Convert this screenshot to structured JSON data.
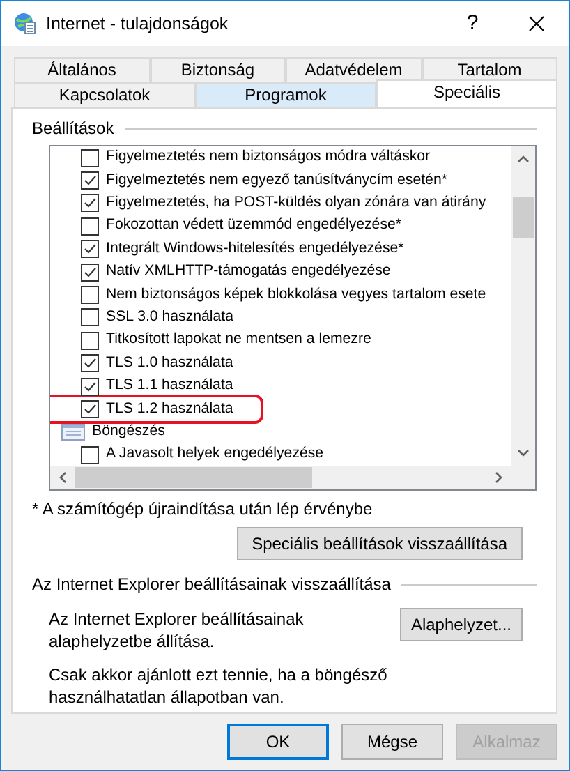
{
  "window": {
    "title": "Internet - tulajdonságok",
    "help": "?"
  },
  "tab_rows": [
    [
      {
        "label": "Általános",
        "selected": false,
        "hovered": false
      },
      {
        "label": "Biztonság",
        "selected": false,
        "hovered": false
      },
      {
        "label": "Adatvédelem",
        "selected": false,
        "hovered": false
      },
      {
        "label": "Tartalom",
        "selected": false,
        "hovered": false
      }
    ],
    [
      {
        "label": "Kapcsolatok",
        "selected": false,
        "hovered": false
      },
      {
        "label": "Programok",
        "selected": false,
        "hovered": true
      },
      {
        "label": "Speciális",
        "selected": true,
        "hovered": false
      }
    ]
  ],
  "settings": {
    "legend": "Beállítások",
    "items": [
      {
        "kind": "checkbox",
        "label": "Figyelmeztetés nem biztonságos módra váltáskor",
        "checked": false,
        "highlighted": false
      },
      {
        "kind": "checkbox",
        "label": "Figyelmeztetés nem egyező tanúsítványcím esetén*",
        "checked": true,
        "highlighted": false
      },
      {
        "kind": "checkbox",
        "label": "Figyelmeztetés, ha POST-küldés olyan zónára van átirány",
        "checked": true,
        "highlighted": false
      },
      {
        "kind": "checkbox",
        "label": "Fokozottan védett üzemmód engedélyezése*",
        "checked": false,
        "highlighted": false
      },
      {
        "kind": "checkbox",
        "label": "Integrált Windows-hitelesítés engedélyezése*",
        "checked": true,
        "highlighted": false
      },
      {
        "kind": "checkbox",
        "label": "Natív XMLHTTP-támogatás engedélyezése",
        "checked": true,
        "highlighted": false
      },
      {
        "kind": "checkbox",
        "label": "Nem biztonságos képek blokkolása vegyes tartalom esete",
        "checked": false,
        "highlighted": false
      },
      {
        "kind": "checkbox",
        "label": "SSL 3.0 használata",
        "checked": false,
        "highlighted": false
      },
      {
        "kind": "checkbox",
        "label": "Titkosított lapokat ne mentsen a lemezre",
        "checked": false,
        "highlighted": false
      },
      {
        "kind": "checkbox",
        "label": "TLS 1.0 használata",
        "checked": true,
        "highlighted": false
      },
      {
        "kind": "checkbox",
        "label": "TLS 1.1 használata",
        "checked": true,
        "highlighted": false
      },
      {
        "kind": "checkbox",
        "label": "TLS 1.2 használata",
        "checked": true,
        "highlighted": true
      },
      {
        "kind": "category",
        "label": "Böngészés"
      },
      {
        "kind": "checkbox",
        "label": "A Javasolt helyek engedélyezése",
        "checked": false,
        "highlighted": false
      }
    ],
    "footnote": "* A számítógép újraindítása után lép érvénybe",
    "reset_button": "Speciális beállítások visszaállítása"
  },
  "reset_group": {
    "legend": "Az Internet Explorer beállításainak visszaállítása",
    "description": "Az Internet Explorer beállításainak alaphelyzetbe állítása.",
    "button": "Alaphelyzet...",
    "note": "Csak akkor ajánlott ezt tennie, ha a böngésző használhatatlan állapotban van."
  },
  "buttons": [
    {
      "label": "OK",
      "kind": "default",
      "disabled": false
    },
    {
      "label": "Mégse",
      "kind": "normal",
      "disabled": false
    },
    {
      "label": "Alkalmaz",
      "kind": "normal",
      "disabled": true
    }
  ]
}
